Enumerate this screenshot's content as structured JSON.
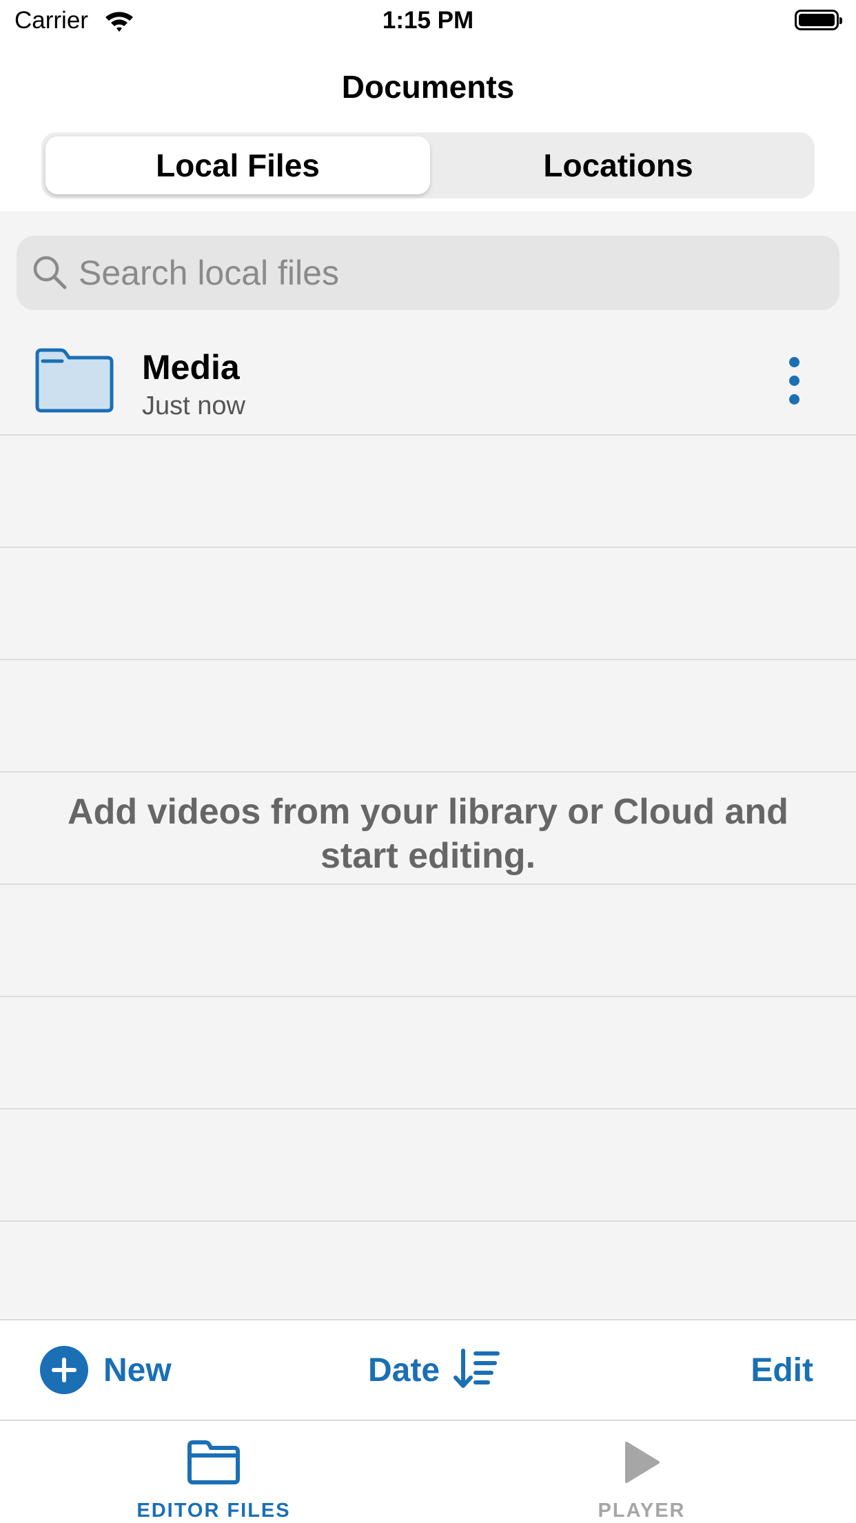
{
  "status_bar": {
    "carrier": "Carrier",
    "time": "1:15 PM"
  },
  "nav": {
    "title": "Documents"
  },
  "segments": {
    "local": "Local Files",
    "locations": "Locations"
  },
  "search": {
    "placeholder": "Search local files"
  },
  "files": [
    {
      "name": "Media",
      "date": "Just now",
      "icon": "folder-icon"
    }
  ],
  "empty_message": "Add videos from your library or Cloud and start editing.",
  "toolbar": {
    "new_label": "New",
    "sort_label": "Date",
    "edit_label": "Edit"
  },
  "tabbar": {
    "editor_label": "EDITOR FILES",
    "player_label": "PLAYER"
  },
  "colors": {
    "accent": "#1a6fb5",
    "inactive": "#a6a6a6",
    "list_bg": "#f4f4f4"
  }
}
